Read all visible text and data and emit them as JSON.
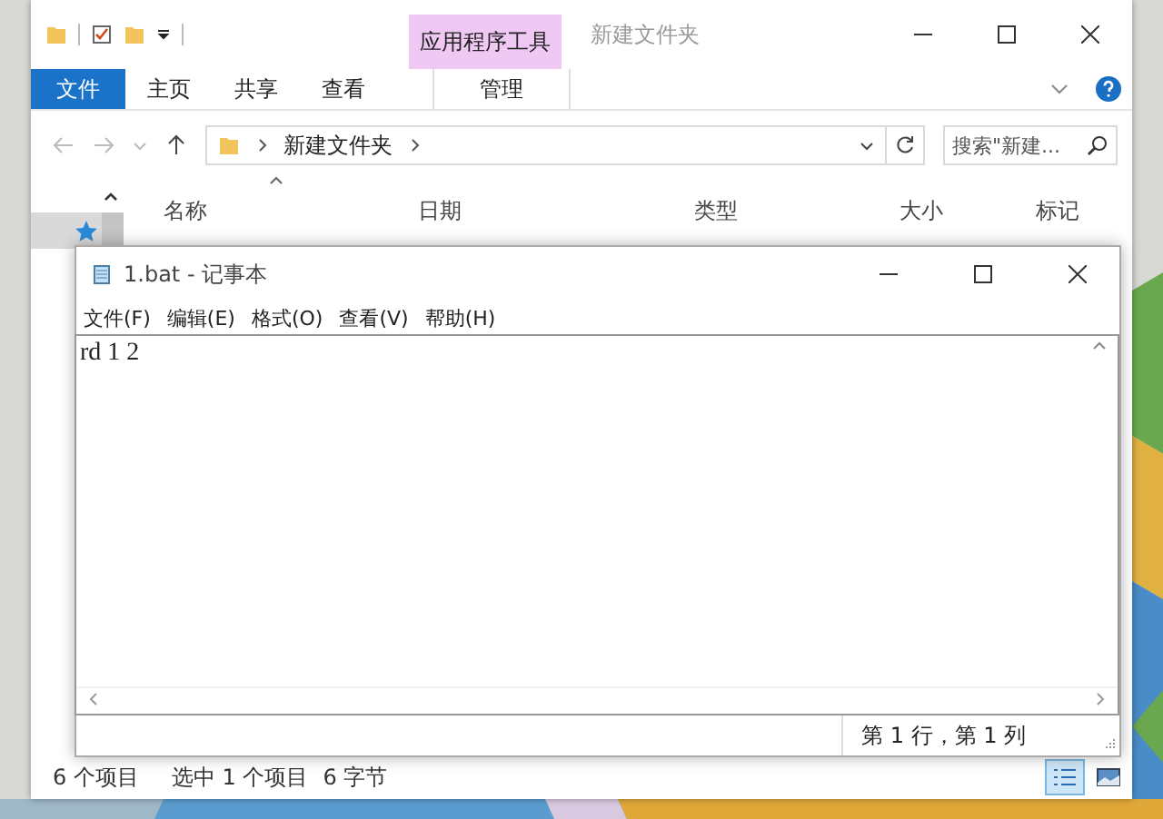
{
  "explorer": {
    "contextual_group": "应用程序工具",
    "title": "新建文件夹",
    "ribbon_tabs": [
      {
        "label": "文件",
        "kind": "file"
      },
      {
        "label": "主页",
        "kind": "tab"
      },
      {
        "label": "共享",
        "kind": "tab"
      },
      {
        "label": "查看",
        "kind": "tab"
      },
      {
        "label": "管理",
        "kind": "contextual"
      }
    ],
    "address": {
      "path": "新建文件夹"
    },
    "search": {
      "placeholder": "搜索\"新建..."
    },
    "nav_items": [
      {
        "kind": "quick-access",
        "selected": true
      }
    ],
    "columns": [
      "名称",
      "日期",
      "类型",
      "大小",
      "标记"
    ],
    "status": {
      "item_count": "6 个项目",
      "selection": "选中 1 个项目",
      "size": "6 字节"
    },
    "views": [
      {
        "kind": "details",
        "selected": true
      },
      {
        "kind": "thumbnails",
        "selected": false
      }
    ]
  },
  "notepad": {
    "title": "1.bat - 记事本",
    "menus": [
      "文件(F)",
      "编辑(E)",
      "格式(O)",
      "查看(V)",
      "帮助(H)"
    ],
    "content": "rd 1 2",
    "status": "第 1 行，第 1 列"
  }
}
